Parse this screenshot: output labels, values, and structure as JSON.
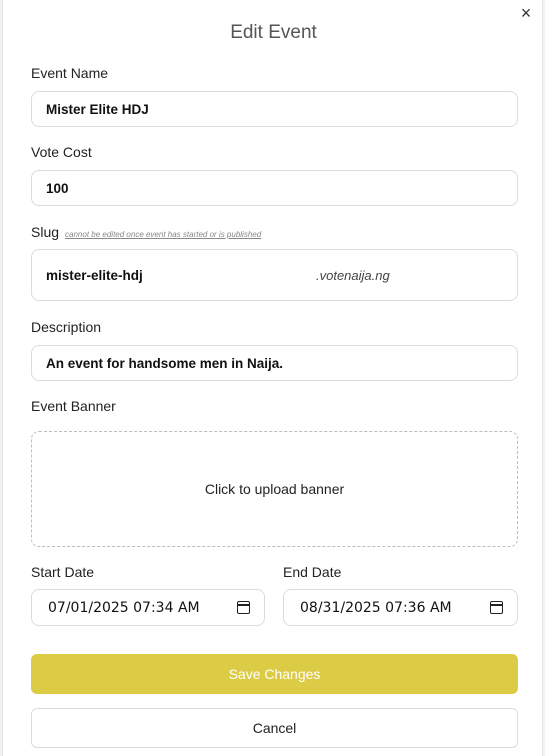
{
  "modal": {
    "title": "Edit Event",
    "close_icon": "×"
  },
  "fields": {
    "event_name": {
      "label": "Event Name",
      "value": "Mister Elite HDJ"
    },
    "vote_cost": {
      "label": "Vote Cost",
      "value": "100"
    },
    "slug": {
      "label": "Slug",
      "hint": "cannot be edited once event has started or is published",
      "value": "mister-elite-hdj",
      "suffix": ".votenaija.ng"
    },
    "description": {
      "label": "Description",
      "value": "An event for handsome men in Naija."
    },
    "banner": {
      "label": "Event Banner",
      "upload_text": "Click to upload banner"
    },
    "start_date": {
      "label": "Start Date",
      "value": "07/01/2025 07:34 AM"
    },
    "end_date": {
      "label": "End Date",
      "value": "08/31/2025 07:36 AM"
    }
  },
  "actions": {
    "save_label": "Save Changes",
    "cancel_label": "Cancel"
  },
  "colors": {
    "save_button": "#dccb45"
  }
}
